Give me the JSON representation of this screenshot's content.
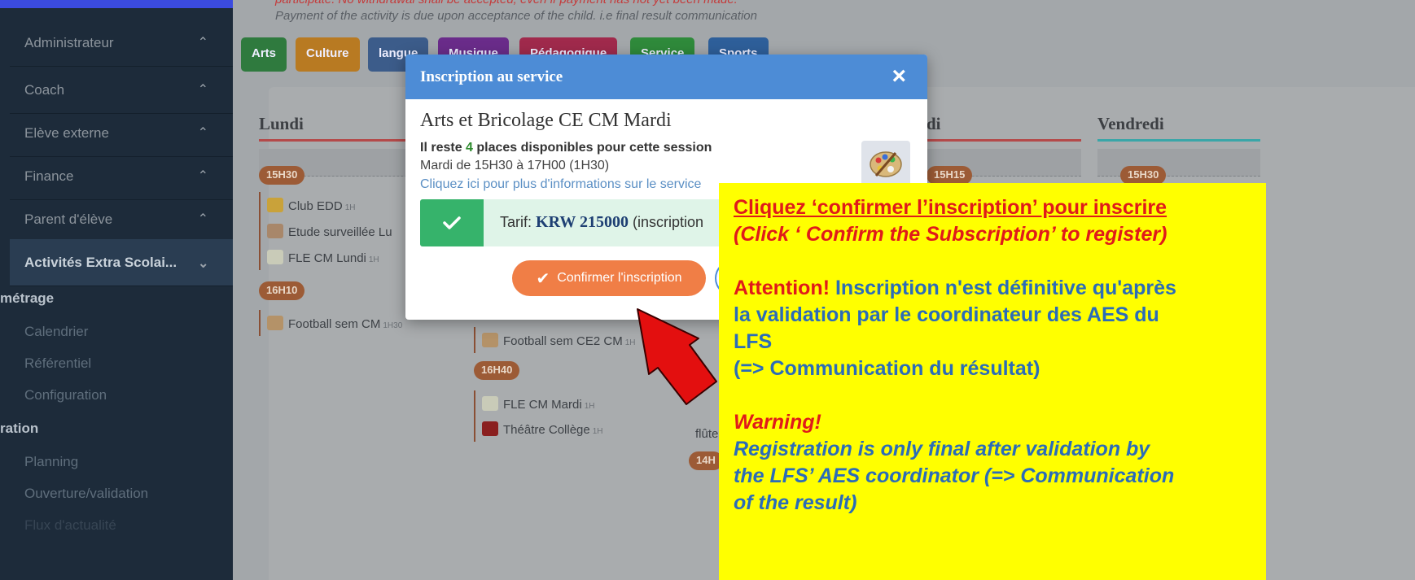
{
  "sidebar": {
    "items": [
      {
        "label": "Administrateur"
      },
      {
        "label": "Coach"
      },
      {
        "label": "Elève externe"
      },
      {
        "label": "Finance"
      },
      {
        "label": "Parent d'élève"
      },
      {
        "label": "Activités Extra Scolai..."
      }
    ],
    "section1": "métrage",
    "sub1": [
      "Calendrier",
      "Référentiel",
      "Configuration"
    ],
    "section2": "ration",
    "sub2": [
      "Planning",
      "Ouverture/validation",
      "Flux d'actualité"
    ]
  },
  "main": {
    "notice_top": "participate. No withdrawal shall be accepted, even if payment has not yet been made.",
    "notice_line": "Payment of the activity is due upon acceptance of the child. i.e final result communication",
    "tags": [
      {
        "label": "Arts",
        "color": "#2f7a3e"
      },
      {
        "label": "Culture",
        "color": "#b87a22"
      },
      {
        "label": "langue",
        "color": "#3c5c8a"
      },
      {
        "label": "Musique",
        "color": "#6a2c8a"
      },
      {
        "label": "Pédagogique",
        "color": "#a02a4c"
      },
      {
        "label": "Service",
        "color": "#2f8a3b"
      },
      {
        "label": "Sports",
        "color": "#2e5f9a"
      }
    ],
    "days": [
      "Lundi",
      "di",
      "Vendredi"
    ],
    "lundi": {
      "slots": [
        {
          "time": "15H30",
          "activities": [
            {
              "name": "Club EDD",
              "dur": "1H"
            },
            {
              "name": "Etude surveillée Lu",
              "dur": ""
            },
            {
              "name": "FLE CM Lundi",
              "dur": "1H"
            }
          ]
        },
        {
          "time": "16H10",
          "activities": [
            {
              "name": "Football sem CM",
              "dur": "1H30"
            }
          ]
        }
      ]
    },
    "mardi": {
      "activities_top": [
        {
          "name": "Football sem CE2 CM",
          "dur": "1H"
        }
      ],
      "time2": "16H40",
      "activities2": [
        {
          "name": "FLE CM Mardi",
          "dur": "1H"
        },
        {
          "name": "Théâtre Collège",
          "dur": "1H"
        }
      ]
    },
    "jeudi": {
      "time": "15H15",
      "time2": "14H",
      "text": "flûte"
    },
    "vendredi": {
      "time": "15H30"
    }
  },
  "modal": {
    "title": "Inscription au service",
    "close_label": "×",
    "activity_name": "Arts et Bricolage CE CM Mardi",
    "places_prefix": "Il reste ",
    "places_num": "4",
    "places_suffix": " places disponibles pour cette session",
    "schedule": "Mardi de 15H30 à 17H00 (1H30)",
    "info_link": "Cliquez ici pour plus d'informations sur le service",
    "tarif_label": "Tarif: ",
    "tarif_amount": "KRW 215000",
    "tarif_suffix": " (inscription",
    "confirm_label": "Confirmer l'inscription"
  },
  "callout": {
    "line1": "Cliquez ‘confirmer l’inscription’ pour inscrire",
    "line2": "(Click ‘ Confirm the Subscription’ to register)",
    "attention_label": "Attention!",
    "attention_text": " Inscription n'est définitive qu'après",
    "line4": "la validation par le coordinateur des AES du",
    "line5": "LFS",
    "line6": "(=> Communication du résultat)",
    "warning_label": "Warning!",
    "warning_l1": "Registration is only final after validation by",
    "warning_l2": "the LFS’ AES coordinator (=> Communication",
    "warning_l3": "of the result)"
  },
  "colors": {
    "accent": "#4d8cd6",
    "confirm": "#f07e46",
    "success": "#36b36b",
    "callout_bg": "#ffff00",
    "callout_red": "#e01a1a",
    "callout_blue": "#2b6cb8"
  }
}
